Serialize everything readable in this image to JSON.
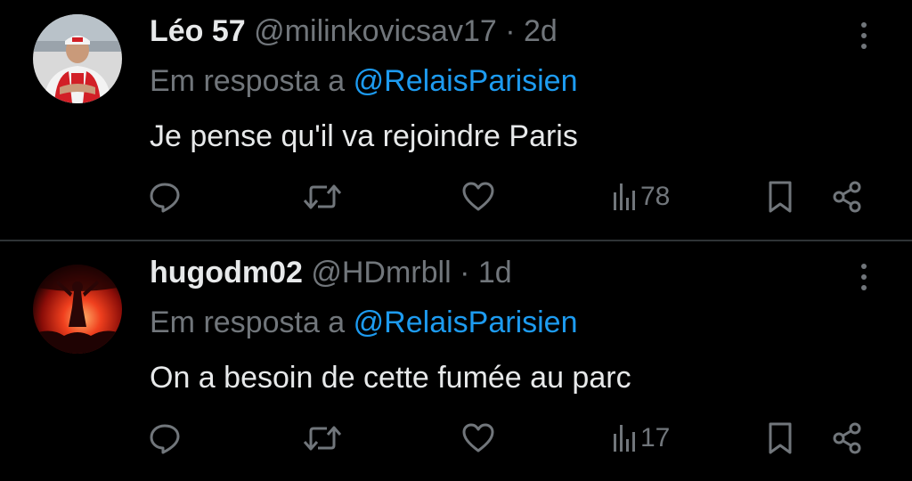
{
  "tweets": [
    {
      "name": "Léo 57",
      "handle": "@milinkovicsav17",
      "separator": "·",
      "time": "2d",
      "reply_prefix": "Em resposta a",
      "reply_to": "@RelaisParisien",
      "text": "Je pense qu'il va rejoindre Paris",
      "views": "78",
      "avatar_icon": "driver-avatar"
    },
    {
      "name": "hugodm02",
      "handle": "@HDmrbll",
      "separator": "·",
      "time": "1d",
      "reply_prefix": "Em resposta a",
      "reply_to": "@RelaisParisien",
      "text": "On a besoin de cette fumée au parc",
      "views": "17",
      "avatar_icon": "flare-crowd-avatar"
    }
  ],
  "colors": {
    "background": "#000000",
    "text": "#e7e9ea",
    "muted": "#71767b",
    "link": "#1d9bf0",
    "divider": "#2f3336"
  },
  "icons": [
    "reply-icon",
    "retweet-icon",
    "like-icon",
    "views-icon",
    "bookmark-icon",
    "share-icon",
    "more-icon"
  ]
}
